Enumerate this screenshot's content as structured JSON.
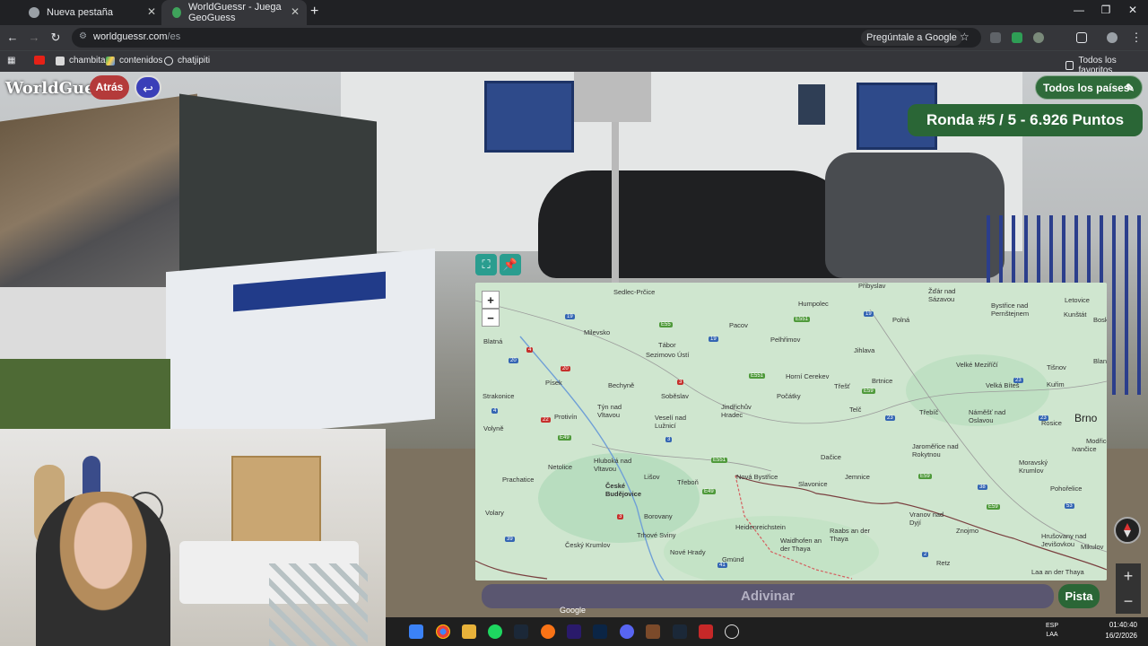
{
  "browser": {
    "tabs": [
      {
        "label": "Nueva pestaña",
        "active": false
      },
      {
        "label": "WorldGuessr - Juega GeoGuess",
        "active": true
      }
    ],
    "url_host": "worldguessr.com",
    "url_path": "/es",
    "ask_google_label": "Pregúntale a Google",
    "bookmarks": [
      {
        "label": "",
        "icon": "youtube-icon"
      },
      {
        "label": "chambita",
        "icon": "bookmark-icon"
      },
      {
        "label": "contenidos",
        "icon": "drive-icon"
      },
      {
        "label": "chatjipiti",
        "icon": "chatgpt-icon"
      }
    ],
    "all_bookmarks_label": "Todos los favoritos"
  },
  "game": {
    "logo": "WorldGuessr",
    "back_label": "Atrás",
    "countries_label": "Todos los países",
    "round_label": "Ronda #5 / 5 - 6.926 Puntos",
    "guess_label": "Adivinar",
    "hint_label": "Pista",
    "google_mark": "Google",
    "zoom_in": "+",
    "zoom_out": "−"
  },
  "map": {
    "places": [
      {
        "name": "Sedlec-Prčice"
      },
      {
        "name": "Humpolec"
      },
      {
        "name": "Přibyslav"
      },
      {
        "name": "Žďár nad Sázavou"
      },
      {
        "name": "Bystřice nad Pernštejnem"
      },
      {
        "name": "Letovice"
      },
      {
        "name": "Kunštát"
      },
      {
        "name": "Boskov"
      },
      {
        "name": "Milevsko"
      },
      {
        "name": "Pacov"
      },
      {
        "name": "Polná"
      },
      {
        "name": "Blatná"
      },
      {
        "name": "Tábor"
      },
      {
        "name": "Sezimovo Ústí"
      },
      {
        "name": "Pelhřimov"
      },
      {
        "name": "Jihlava"
      },
      {
        "name": "Velké Meziříčí"
      },
      {
        "name": "Tišnov"
      },
      {
        "name": "Blansko"
      },
      {
        "name": "Písek"
      },
      {
        "name": "Bechyně"
      },
      {
        "name": "Horní Cerekev"
      },
      {
        "name": "Třešť"
      },
      {
        "name": "Brtnice"
      },
      {
        "name": "Velká Bíteš"
      },
      {
        "name": "Kuřim"
      },
      {
        "name": "Strakonice"
      },
      {
        "name": "Soběslav"
      },
      {
        "name": "Počátky"
      },
      {
        "name": "Protivín"
      },
      {
        "name": "Týn nad Vltavou"
      },
      {
        "name": "Veselí nad Lužnicí"
      },
      {
        "name": "Jindřichův Hradec"
      },
      {
        "name": "Telč"
      },
      {
        "name": "Třebíč"
      },
      {
        "name": "Náměšť nad Oslavou"
      },
      {
        "name": "Rosice"
      },
      {
        "name": "Brno"
      },
      {
        "name": "Volyně"
      },
      {
        "name": "Ivančice"
      },
      {
        "name": "Modřice"
      },
      {
        "name": "Jaroměřice nad Rokytnou"
      },
      {
        "name": "Netolice"
      },
      {
        "name": "Hluboká nad Vltavou"
      },
      {
        "name": "Dačice"
      },
      {
        "name": "Moravský Krumlov"
      },
      {
        "name": "Prachatice"
      },
      {
        "name": "České Budějovice"
      },
      {
        "name": "Lišov"
      },
      {
        "name": "Třeboň"
      },
      {
        "name": "Nová Bystřice"
      },
      {
        "name": "Jemnice"
      },
      {
        "name": "Slavonice"
      },
      {
        "name": "Pohořelice"
      },
      {
        "name": "Volary"
      },
      {
        "name": "Borovany"
      },
      {
        "name": "Vranov nad Dyjí"
      },
      {
        "name": "Znojmo"
      },
      {
        "name": "Heidenreichstein"
      },
      {
        "name": "Raabs an der Thaya"
      },
      {
        "name": "Hrušovany nad Jevišovkou"
      },
      {
        "name": "Český Krumlov"
      },
      {
        "name": "Trhové Sviny"
      },
      {
        "name": "Waidhofen an der Thaya"
      },
      {
        "name": "Mikulov"
      },
      {
        "name": "Nové Hrady"
      },
      {
        "name": "Gmünd"
      },
      {
        "name": "Retz"
      },
      {
        "name": "Laa an der Thaya"
      }
    ]
  },
  "taskbar": {
    "lang_1": "ESP",
    "lang_2": "LAA",
    "time": "01:40:40",
    "date": "16/2/2026"
  }
}
